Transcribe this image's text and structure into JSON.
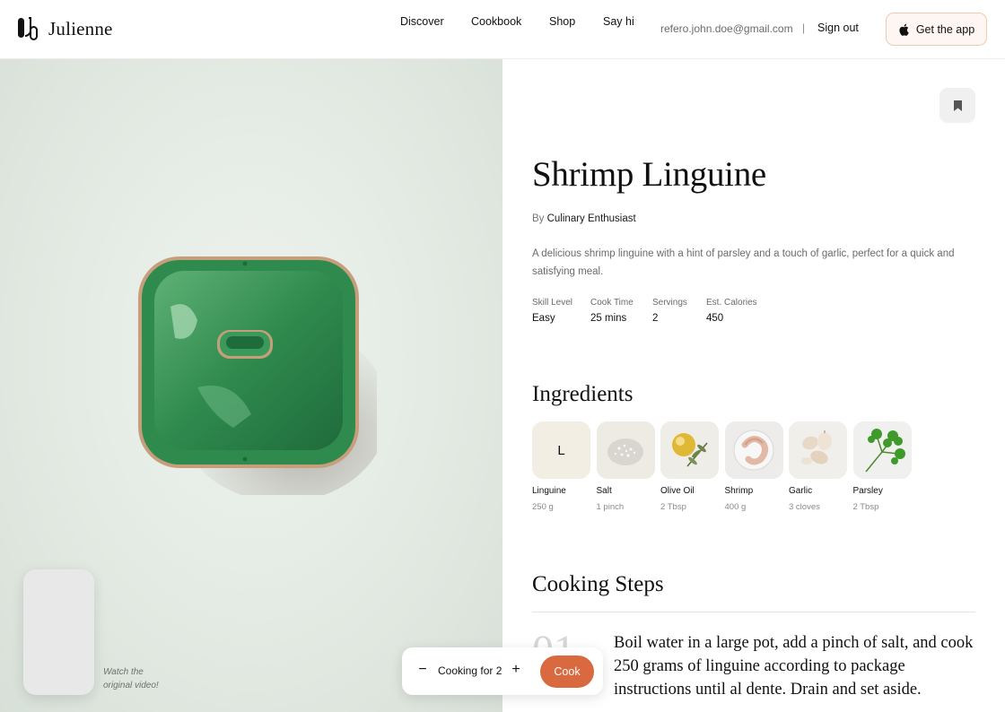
{
  "header": {
    "brand": "Julienne",
    "nav": [
      "Discover",
      "Cookbook",
      "Shop",
      "Say hi"
    ],
    "email": "refero.john.doe@gmail.com",
    "separator": "|",
    "sign_out": "Sign out",
    "get_app": "Get the app"
  },
  "hero": {
    "video_caption_line1": "Watch the",
    "video_caption_line2": "original video!"
  },
  "recipe": {
    "title": "Shrimp Linguine",
    "by_prefix": "By",
    "author": "Culinary Enthusiast",
    "description": "A delicious shrimp linguine with a hint of parsley and a touch of garlic, perfect for a quick and satisfying meal.",
    "stats": [
      {
        "label": "Skill Level",
        "value": "Easy"
      },
      {
        "label": "Cook Time",
        "value": "25 mins"
      },
      {
        "label": "Servings",
        "value": "2"
      },
      {
        "label": "Est. Calories",
        "value": "450"
      }
    ],
    "ingredients_title": "Ingredients",
    "ingredients": [
      {
        "name": "Linguine",
        "qty": "250 g",
        "letter": "L"
      },
      {
        "name": "Salt",
        "qty": "1 pinch"
      },
      {
        "name": "Olive Oil",
        "qty": "2 Tbsp"
      },
      {
        "name": "Shrimp",
        "qty": "400 g"
      },
      {
        "name": "Garlic",
        "qty": "3 cloves"
      },
      {
        "name": "Parsley",
        "qty": "2 Tbsp"
      }
    ],
    "steps_title": "Cooking Steps",
    "steps": [
      {
        "number": "01",
        "text": "Boil water in a large pot, add a pinch of salt, and cook 250 grams of linguine according to package instructions until al dente. Drain and set aside."
      }
    ]
  },
  "cook_bar": {
    "minus": "−",
    "label": "Cooking for 2",
    "plus": "+",
    "cook": "Cook"
  },
  "colors": {
    "accent": "#d96a3f",
    "app_button_border": "#f2c9b5",
    "hero_bg": "#e3eae3"
  }
}
